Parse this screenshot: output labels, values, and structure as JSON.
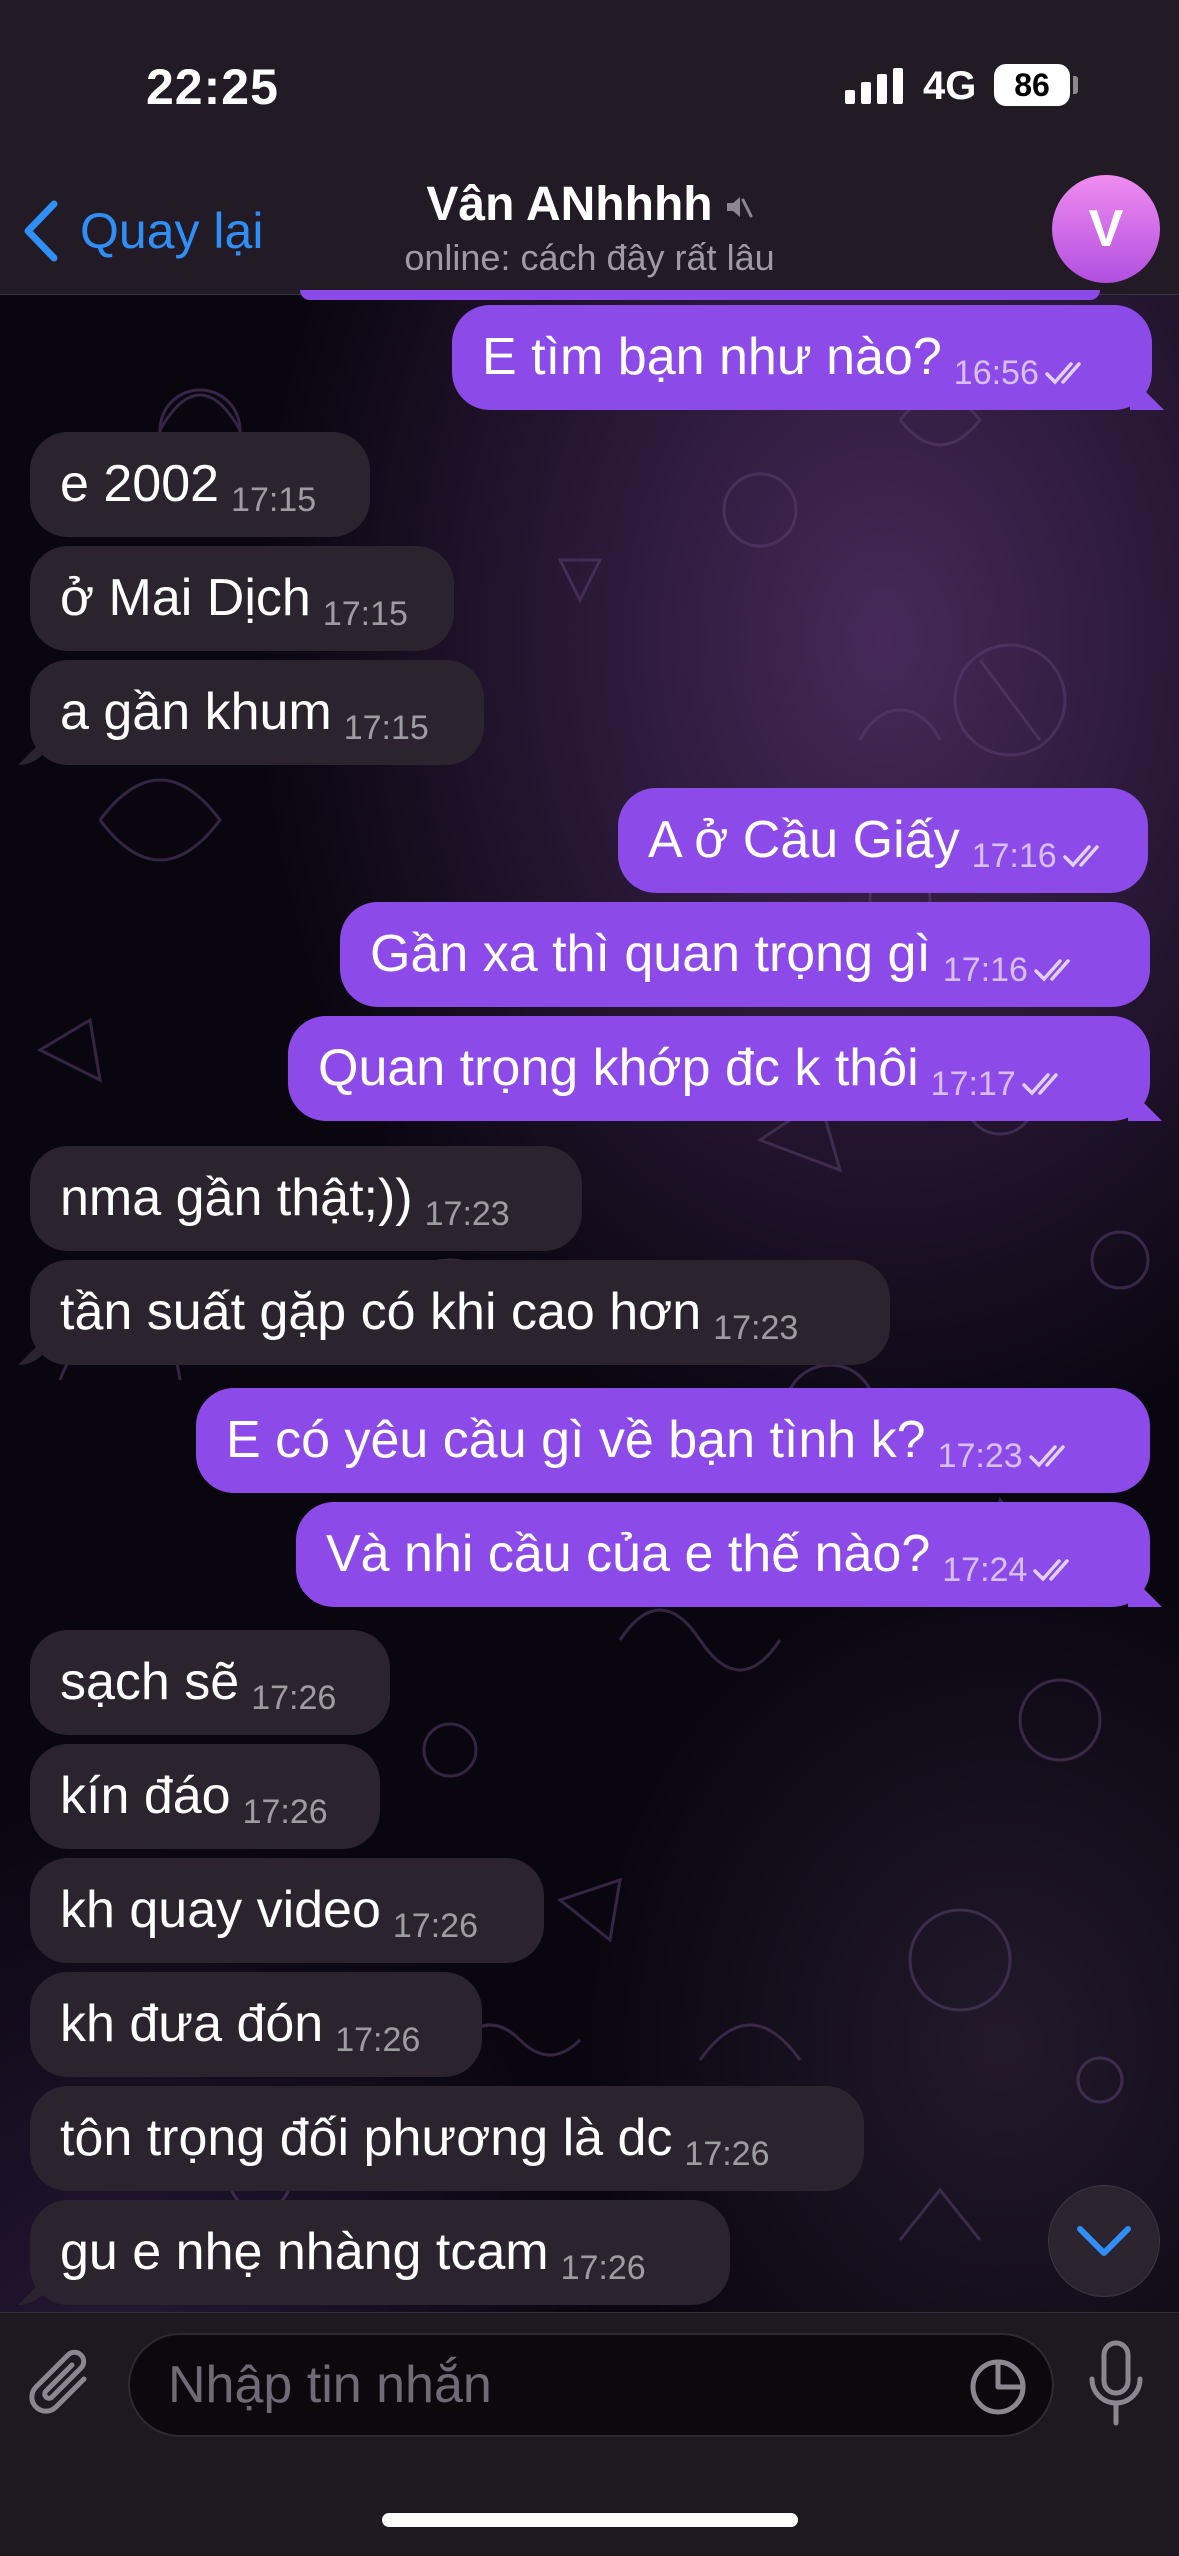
{
  "status_bar": {
    "time": "22:25",
    "network": "4G",
    "battery": "86"
  },
  "header": {
    "back_label": "Quay lại",
    "title": "Vân ANhhhh",
    "subtitle": "online: cách đây rất lâu",
    "avatar_letter": "V"
  },
  "messages": [
    {
      "dir": "out",
      "text": "E tìm bạn như nào?",
      "time": "16:56"
    },
    {
      "dir": "in",
      "text": "e 2002",
      "time": "17:15"
    },
    {
      "dir": "in",
      "text": "ở Mai Dịch",
      "time": "17:15"
    },
    {
      "dir": "in",
      "text": "a gần khum",
      "time": "17:15"
    },
    {
      "dir": "out",
      "text": "A ở Cầu Giấy",
      "time": "17:16"
    },
    {
      "dir": "out",
      "text": "Gần xa thì quan trọng gì",
      "time": "17:16"
    },
    {
      "dir": "out",
      "text": "Quan trọng khớp đc k thôi",
      "time": "17:17"
    },
    {
      "dir": "in",
      "text": "nma gần thật;))",
      "time": "17:23"
    },
    {
      "dir": "in",
      "text": "tần suất gặp có khi cao hơn",
      "time": "17:23"
    },
    {
      "dir": "out",
      "text": "E có yêu cầu gì về bạn tình k?",
      "time": "17:23"
    },
    {
      "dir": "out",
      "text": "Và nhi cầu của e thế nào?",
      "time": "17:24"
    },
    {
      "dir": "in",
      "text": "sạch sẽ",
      "time": "17:26"
    },
    {
      "dir": "in",
      "text": "kín đáo",
      "time": "17:26"
    },
    {
      "dir": "in",
      "text": "kh quay video",
      "time": "17:26"
    },
    {
      "dir": "in",
      "text": "kh đưa đón",
      "time": "17:26"
    },
    {
      "dir": "in",
      "text": "tôn trọng đối phương là dc",
      "time": "17:26"
    },
    {
      "dir": "in",
      "text": "gu e nhẹ nhàng tcam",
      "time": "17:26"
    }
  ],
  "input": {
    "placeholder": "Nhập tin nhắn"
  },
  "colors": {
    "outgoing": "#8c4be8",
    "incoming": "#2b242f",
    "link": "#2f8ff7"
  },
  "icons": [
    "back-chevron-icon",
    "mute-icon",
    "read-check-icon",
    "scroll-down-icon",
    "paperclip-icon",
    "sticker-icon",
    "mic-icon"
  ]
}
